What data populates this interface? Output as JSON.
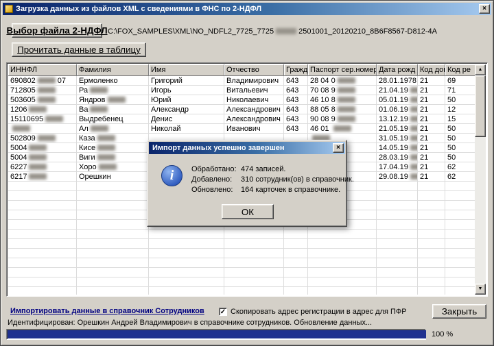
{
  "window": {
    "title": "Загрузка данных из файлов XML с сведениями в ФНС по 2-НДФЛ"
  },
  "icons": {
    "close": "×",
    "up": "▲",
    "down": "▼",
    "check": "✓",
    "info": "i"
  },
  "toolbar": {
    "select_file_label": "Выбор файла 2-НДФЛ",
    "file_path": "C:\\FOX_SAMPLES\\XML\\NO_NDFL2_7725_7725~~2501001_20120210_8B6F8567-D812-4A",
    "read_label": "Прочитать данные в таблицу"
  },
  "table": {
    "columns": [
      "ИННФЛ",
      "Фамилия",
      "Имя",
      "Отчество",
      "Гражд",
      "Паспорт сер.номер",
      "Дата рожд",
      "Код док",
      "Код ре"
    ],
    "rows": [
      [
        "690802~~07",
        "Ермоленко",
        "Григорий",
        "Владимирович",
        "643",
        "28 04 0~~",
        "28.01.1978",
        "21",
        "69"
      ],
      [
        "712805~~",
        "Ра~~",
        "Игорь",
        "Витальевич",
        "643",
        "70 08 9~~",
        "21.04.19~~",
        "21",
        "71"
      ],
      [
        "503605~~",
        "Яндров~~",
        "Юрий",
        "Николаевич",
        "643",
        "46 10 8~~",
        "05.01.19~~",
        "21",
        "50"
      ],
      [
        "1206~~",
        "Ва~~",
        "Александр",
        "Александрович",
        "643",
        "88 05 8~~",
        "01.06.19~~",
        "21",
        "12"
      ],
      [
        "15110695~~",
        "Выдребенец",
        "Денис",
        "Александрович",
        "643",
        "90 08 9~~",
        "13.12.19~~",
        "21",
        "15"
      ],
      [
        "~~",
        "Ал~~",
        "Николай",
        "Иванович",
        "643",
        "46 01 ~~",
        "21.05.19~~",
        "21",
        "50"
      ],
      [
        "502809~~",
        "Каза~~",
        "",
        "",
        "",
        "~~",
        "31.05.19~~",
        "21",
        "50"
      ],
      [
        "5004~~",
        "Кисе~~",
        "",
        "",
        "",
        "~~",
        "14.05.19~~",
        "21",
        "50"
      ],
      [
        "5004~~",
        "Виги~~",
        "",
        "",
        "",
        "~~",
        "28.03.19~~",
        "21",
        "50"
      ],
      [
        "6227~~",
        "Хоро~~",
        "",
        "",
        "",
        "~~",
        "17.04.19~~",
        "21",
        "62"
      ],
      [
        "6217~~",
        "Орешкин",
        "",
        "",
        "",
        "~~",
        "29.08.19~~",
        "21",
        "62"
      ]
    ]
  },
  "dialog": {
    "title": "Импорт данных успешно завершен",
    "lines": [
      {
        "label": "Обработано:",
        "value": "474 записей."
      },
      {
        "label": "Добавлено:",
        "value": "310 сотрудник(ов) в справочник."
      },
      {
        "label": "Обновлено:",
        "value": "164 карточек в справочнике."
      }
    ],
    "ok_label": "ОК"
  },
  "footer": {
    "import_link": "Импортировать данные  в справочник Сотрудников",
    "checkbox_label": "Скопировать адрес регистрации в адрес для ПФР",
    "checkbox_checked": true,
    "close_label": "Закрыть",
    "status": "Идентифицирован: Орешкин Андрей Владимирович в справочнике сотрудников. Обновление данных...",
    "progress_label": "100 %",
    "progress_percent": 100
  }
}
